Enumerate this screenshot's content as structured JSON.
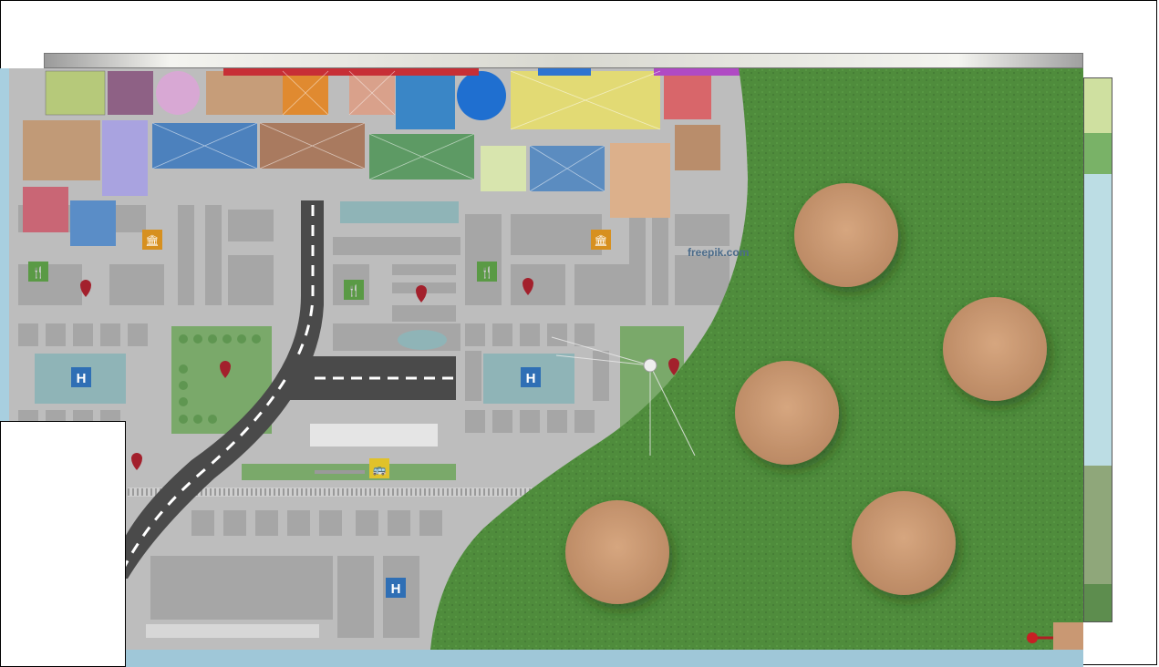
{
  "scene": {
    "watermark_text": "freepik.com",
    "colors": {
      "grass": "#4d8a3a",
      "table": "#c99873",
      "road": "#4a4a4a",
      "map_bg": "#bdbdbd",
      "water": "#9fc7d8"
    }
  },
  "map_icons": {
    "hospital": "H",
    "restaurant": "🍴",
    "museum": "🏛",
    "bus": "🚌"
  },
  "tables": {
    "count": 5
  }
}
